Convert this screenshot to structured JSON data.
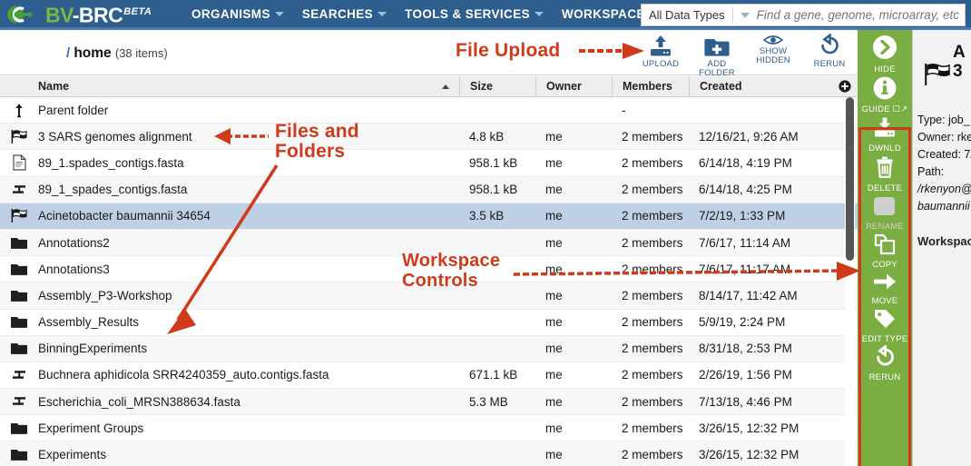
{
  "nav": {
    "logo": {
      "bv": "BV",
      "dash": "-",
      "brc": "BRC",
      "beta": "BETA"
    },
    "items": [
      {
        "label": "ORGANISMS",
        "caret": "chevron-down-icon"
      },
      {
        "label": "SEARCHES",
        "caret": "chevron-down-icon"
      },
      {
        "label": "TOOLS & SERVICES",
        "caret": "chevron-down-icon"
      },
      {
        "label": "WORKSPACES",
        "caret": "chevron-down-icon"
      }
    ],
    "search": {
      "data_type": "All Data Types",
      "placeholder": "Find a gene, genome, microarray, etc",
      "value": ""
    },
    "colors": {
      "navbar": "#2e5e8e",
      "logo_green": "#76b947"
    }
  },
  "breadcrumb": {
    "slash": "/",
    "path": "home",
    "count": "(38 items)"
  },
  "toolbar": {
    "buttons": [
      {
        "label": "UPLOAD",
        "icon": "upload-icon"
      },
      {
        "label": "ADD FOLDER",
        "icon": "add-folder-icon"
      },
      {
        "label": "SHOW\nHIDDEN",
        "label_line1": "SHOW",
        "label_line2": "HIDDEN",
        "icon": "eye-icon"
      },
      {
        "label": "RERUN",
        "icon": "rerun-icon"
      }
    ]
  },
  "table": {
    "columns": [
      {
        "key": "name",
        "label": "Name",
        "sorted": "asc"
      },
      {
        "key": "size",
        "label": "Size"
      },
      {
        "key": "owner",
        "label": "Owner"
      },
      {
        "key": "members",
        "label": "Members"
      },
      {
        "key": "created",
        "label": "Created"
      }
    ],
    "settings_icon": "plus-circle-icon",
    "rows": [
      {
        "icon": "parent-folder-icon",
        "name": "Parent folder",
        "size": "",
        "owner": "",
        "members": "-",
        "created": "",
        "selected": false
      },
      {
        "icon": "alignment-flag-icon",
        "name": "3 SARS genomes alignment",
        "size": "4.8 kB",
        "owner": "me",
        "members": "2 members",
        "created": "12/16/21, 9:26 AM",
        "selected": false
      },
      {
        "icon": "document-icon",
        "name": "89_1.spades_contigs.fasta",
        "size": "958.1 kB",
        "owner": "me",
        "members": "2 members",
        "created": "6/14/18, 4:19 PM",
        "selected": false
      },
      {
        "icon": "contigs-icon",
        "name": "89_1_spades_contigs.fasta",
        "size": "958.1 kB",
        "owner": "me",
        "members": "2 members",
        "created": "6/14/18, 4:25 PM",
        "selected": false
      },
      {
        "icon": "alignment-flag-icon",
        "name": "Acinetobacter baumannii 34654",
        "size": "3.5 kB",
        "owner": "me",
        "members": "2 members",
        "created": "7/2/19, 1:33 PM",
        "selected": true
      },
      {
        "icon": "folder-icon",
        "name": "Annotations2",
        "size": "",
        "owner": "me",
        "members": "2 members",
        "created": "7/6/17, 11:14 AM",
        "selected": false
      },
      {
        "icon": "folder-icon",
        "name": "Annotations3",
        "size": "",
        "owner": "me",
        "members": "2 members",
        "created": "7/6/17, 11:17 AM",
        "selected": false
      },
      {
        "icon": "folder-icon",
        "name": "Assembly_P3-Workshop",
        "size": "",
        "owner": "me",
        "members": "2 members",
        "created": "8/14/17, 11:42 AM",
        "selected": false
      },
      {
        "icon": "folder-icon",
        "name": "Assembly_Results",
        "size": "",
        "owner": "me",
        "members": "2 members",
        "created": "5/9/19, 2:24 PM",
        "selected": false
      },
      {
        "icon": "folder-icon",
        "name": "BinningExperiments",
        "size": "",
        "owner": "me",
        "members": "2 members",
        "created": "8/31/18, 2:53 PM",
        "selected": false
      },
      {
        "icon": "contigs-icon",
        "name": "Buchnera aphidicola SRR4240359_auto.contigs.fasta",
        "size": "671.1 kB",
        "owner": "me",
        "members": "2 members",
        "created": "2/26/19, 1:56 PM",
        "selected": false
      },
      {
        "icon": "contigs-icon",
        "name": "Escherichia_coli_MRSN388634.fasta",
        "size": "5.3 MB",
        "owner": "me",
        "members": "2 members",
        "created": "7/13/18, 4:46 PM",
        "selected": false
      },
      {
        "icon": "folder-icon",
        "name": "Experiment Groups",
        "size": "",
        "owner": "me",
        "members": "2 members",
        "created": "3/26/15, 12:32 PM",
        "selected": false
      },
      {
        "icon": "folder-icon",
        "name": "Experiments",
        "size": "",
        "owner": "me",
        "members": "2 members",
        "created": "3/26/15, 12:32 PM",
        "selected": false
      }
    ]
  },
  "rail": {
    "background": "#7aad42",
    "buttons": [
      {
        "label": "HIDE",
        "icon": "chevron-right-circle-icon",
        "enabled": true
      },
      {
        "label": "GUIDE",
        "icon": "info-circle-icon",
        "enabled": true,
        "external": true
      },
      {
        "label": "DWNLD",
        "icon": "download-icon",
        "enabled": true
      },
      {
        "label": "DELETE",
        "icon": "trash-icon",
        "enabled": true
      },
      {
        "label": "RENAME",
        "icon": "pencil-icon",
        "enabled": false
      },
      {
        "label": "COPY",
        "icon": "copy-icon",
        "enabled": true
      },
      {
        "label": "MOVE",
        "icon": "arrow-right-icon",
        "enabled": true
      },
      {
        "label": "EDIT TYPE",
        "icon": "tag-icon",
        "enabled": true
      },
      {
        "label": "RERUN",
        "icon": "rerun-icon",
        "enabled": true
      }
    ]
  },
  "detail": {
    "icon": "alignment-flag-icon",
    "title_line1": "A",
    "title_line2": "3",
    "meta": [
      "Type: job_",
      "Owner: rke",
      "Created: 7/",
      "Path:",
      "/rkenyon@",
      "baumannii"
    ],
    "section": "Workspac"
  },
  "annotations": {
    "file_upload": "File Upload",
    "files_and_folders_line1": "Files and",
    "files_and_folders_line2": "Folders",
    "workspace_controls_line1": "Workspace",
    "workspace_controls_line2": "Controls",
    "color": "#cf3a1b"
  }
}
